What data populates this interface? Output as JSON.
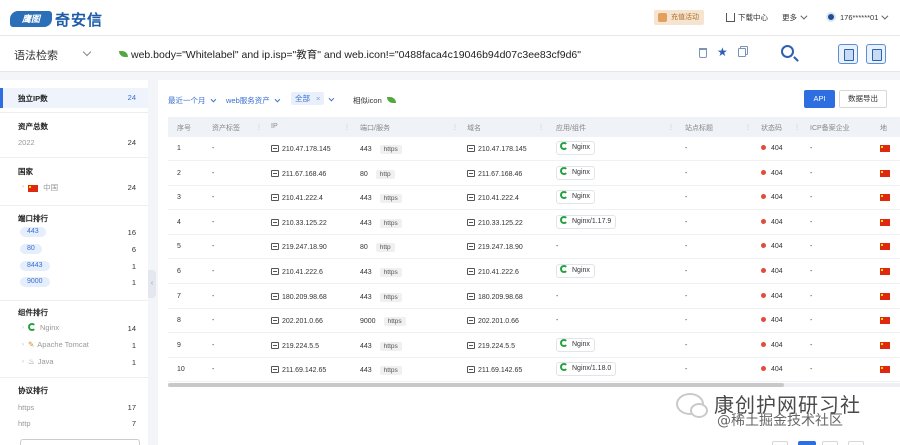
{
  "header": {
    "logo_text": "奇安信",
    "logo_mark": "鹰图",
    "promo": "充值活动",
    "download": "下载中心",
    "more": "更多",
    "user": "176******01"
  },
  "search": {
    "mode": "语法检索",
    "query": "web.body=\"Whitelabel\" and ip.isp=\"教育\" and web.icon!=\"0488faca4c19046b94d07c3ee83cf9d6\""
  },
  "left_panel": {
    "unique_ip": {
      "label": "独立IP数",
      "count": "24"
    },
    "assets": {
      "label": "资产总数",
      "year": "2022",
      "count": "24"
    },
    "country": {
      "label": "国家",
      "items": [
        {
          "label": "中国",
          "count": "24"
        }
      ]
    },
    "ports": {
      "label": "端口排行",
      "items": [
        {
          "label": "443",
          "count": "16"
        },
        {
          "label": "80",
          "count": "6"
        },
        {
          "label": "8443",
          "count": "1"
        },
        {
          "label": "9000",
          "count": "1"
        }
      ]
    },
    "components": {
      "label": "组件排行",
      "items": [
        {
          "label": "Nginx",
          "count": "14"
        },
        {
          "label": "Apache Tomcat",
          "count": "1"
        },
        {
          "label": "Java",
          "count": "1"
        }
      ]
    },
    "protocols": {
      "label": "协议排行",
      "items": [
        {
          "label": "https",
          "count": "17"
        },
        {
          "label": "http",
          "count": "7"
        }
      ]
    }
  },
  "filters": {
    "time": "最近一个月",
    "asset_type": "web服务资产",
    "scope": "全部",
    "similar_icon": "相似icon"
  },
  "actions": {
    "api": "API",
    "export": "数据导出"
  },
  "table": {
    "headers": [
      "序号",
      "资产标签",
      "IP",
      "端口/服务",
      "域名",
      "应用/组件",
      "站点标题",
      "状态码",
      "ICP备案企业",
      "地"
    ],
    "rows": [
      {
        "no": "1",
        "tag": "-",
        "ip": "210.47.178.145",
        "port": "443",
        "proto": "https",
        "domain": "210.47.178.145",
        "app": "Nginx",
        "title": "-",
        "status": "404",
        "icp": "-"
      },
      {
        "no": "2",
        "tag": "-",
        "ip": "211.67.168.46",
        "port": "80",
        "proto": "http",
        "domain": "211.67.168.46",
        "app": "Nginx",
        "title": "-",
        "status": "404",
        "icp": "-"
      },
      {
        "no": "3",
        "tag": "-",
        "ip": "210.41.222.4",
        "port": "443",
        "proto": "https",
        "domain": "210.41.222.4",
        "app": "Nginx",
        "title": "-",
        "status": "404",
        "icp": "-"
      },
      {
        "no": "4",
        "tag": "-",
        "ip": "210.33.125.22",
        "port": "443",
        "proto": "https",
        "domain": "210.33.125.22",
        "app": "Nginx/1.17.9",
        "title": "-",
        "status": "404",
        "icp": "-"
      },
      {
        "no": "5",
        "tag": "-",
        "ip": "219.247.18.90",
        "port": "80",
        "proto": "http",
        "domain": "219.247.18.90",
        "app": "-",
        "title": "-",
        "status": "404",
        "icp": "-"
      },
      {
        "no": "6",
        "tag": "-",
        "ip": "210.41.222.6",
        "port": "443",
        "proto": "https",
        "domain": "210.41.222.6",
        "app": "Nginx",
        "title": "-",
        "status": "404",
        "icp": "-"
      },
      {
        "no": "7",
        "tag": "-",
        "ip": "180.209.98.68",
        "port": "443",
        "proto": "https",
        "domain": "180.209.98.68",
        "app": "-",
        "title": "-",
        "status": "404",
        "icp": "-"
      },
      {
        "no": "8",
        "tag": "-",
        "ip": "202.201.0.66",
        "port": "9000",
        "proto": "https",
        "domain": "202.201.0.66",
        "app": "-",
        "title": "-",
        "status": "404",
        "icp": "-"
      },
      {
        "no": "9",
        "tag": "-",
        "ip": "219.224.5.5",
        "port": "443",
        "proto": "https",
        "domain": "219.224.5.5",
        "app": "Nginx",
        "title": "-",
        "status": "404",
        "icp": "-"
      },
      {
        "no": "10",
        "tag": "-",
        "ip": "211.69.142.65",
        "port": "443",
        "proto": "https",
        "domain": "211.69.142.65",
        "app": "Nginx/1.18.0",
        "title": "-",
        "status": "404",
        "icp": "-"
      }
    ]
  },
  "watermark": {
    "main": "康创护网研习社",
    "sub": "@稀土掘金技术社区"
  },
  "colors": {
    "primary": "#2d6fe0",
    "status_red": "#e34b3b",
    "nginx_green": "#27a243"
  }
}
